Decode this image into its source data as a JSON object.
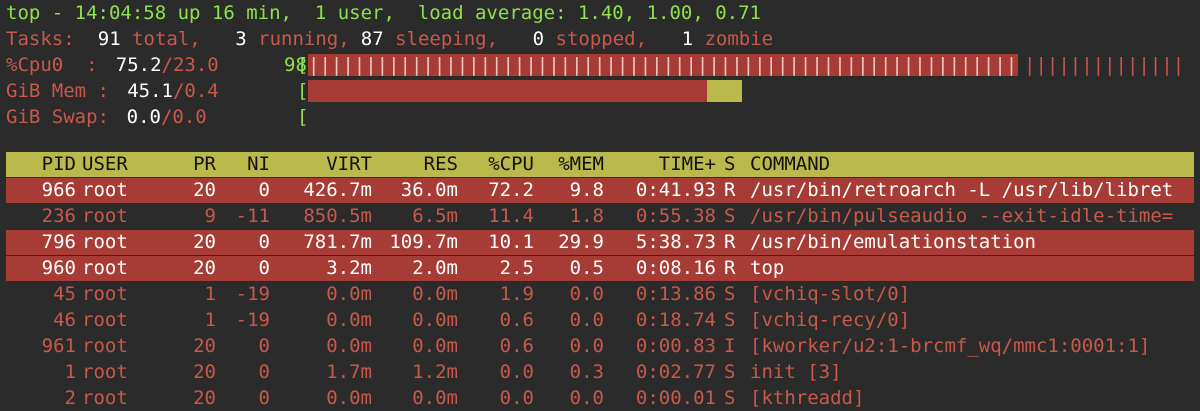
{
  "summary": {
    "line1": "top - 14:04:58 up 16 min,  1 user,  load average: 1.40, 1.00, 0.71",
    "tasks_label": "Tasks:",
    "tasks_total": "91",
    "tasks_total_label": " total,",
    "tasks_running": "3",
    "tasks_running_label": " running,",
    "tasks_sleeping": "87",
    "tasks_sleeping_label": " sleeping,",
    "tasks_stopped": "0",
    "tasks_stopped_label": " stopped,",
    "tasks_zombie": "1",
    "tasks_zombie_label": " zombie",
    "cpu_label": "%Cpu0  :",
    "cpu_user": "75.2",
    "cpu_sys": "/23.0",
    "cpu_total": "98",
    "cpu_bar_open": "[",
    "cpu_usage_fraction": 0.98,
    "mem_label": "GiB Mem :",
    "mem_used": "45.1",
    "mem_buff": "/0.4",
    "mem_bar_open": "[",
    "mem_used_fraction": 0.451,
    "mem_buff_fraction": 0.04,
    "swap_label": "GiB Swap:",
    "swap_used": "0.0",
    "swap_total": "/0.0",
    "swap_bar_open": "["
  },
  "table": {
    "headers": {
      "pid": "PID",
      "user": "USER",
      "pr": "PR",
      "ni": "NI",
      "virt": "VIRT",
      "res": "RES",
      "cpu": "%CPU",
      "mem": "%MEM",
      "time": "TIME+",
      "s": "S",
      "command": "COMMAND"
    },
    "rows": [
      {
        "pid": "966",
        "user": "root",
        "pr": "20",
        "ni": "0",
        "virt": "426.7m",
        "res": "36.0m",
        "cpu": "72.2",
        "mem": "9.8",
        "time": "0:41.93",
        "s": "R",
        "command": "/usr/bin/retroarch -L /usr/lib/libret",
        "style": "hl"
      },
      {
        "pid": "236",
        "user": "root",
        "pr": "9",
        "ni": "-11",
        "virt": "850.5m",
        "res": "6.5m",
        "cpu": "11.4",
        "mem": "1.8",
        "time": "0:55.38",
        "s": "S",
        "command": "/usr/bin/pulseaudio --exit-idle-time=",
        "style": "dim"
      },
      {
        "pid": "796",
        "user": "root",
        "pr": "20",
        "ni": "0",
        "virt": "781.7m",
        "res": "109.7m",
        "cpu": "10.1",
        "mem": "29.9",
        "time": "5:38.73",
        "s": "R",
        "command": "/usr/bin/emulationstation",
        "style": "hl"
      },
      {
        "pid": "960",
        "user": "root",
        "pr": "20",
        "ni": "0",
        "virt": "3.2m",
        "res": "2.0m",
        "cpu": "2.5",
        "mem": "0.5",
        "time": "0:08.16",
        "s": "R",
        "command": "top",
        "style": "hl"
      },
      {
        "pid": "45",
        "user": "root",
        "pr": "1",
        "ni": "-19",
        "virt": "0.0m",
        "res": "0.0m",
        "cpu": "1.9",
        "mem": "0.0",
        "time": "0:13.86",
        "s": "S",
        "command": "[vchiq-slot/0]",
        "style": "dim"
      },
      {
        "pid": "46",
        "user": "root",
        "pr": "1",
        "ni": "-19",
        "virt": "0.0m",
        "res": "0.0m",
        "cpu": "0.6",
        "mem": "0.0",
        "time": "0:18.74",
        "s": "S",
        "command": "[vchiq-recy/0]",
        "style": "dim"
      },
      {
        "pid": "961",
        "user": "root",
        "pr": "20",
        "ni": "0",
        "virt": "0.0m",
        "res": "0.0m",
        "cpu": "0.6",
        "mem": "0.0",
        "time": "0:00.83",
        "s": "I",
        "command": "[kworker/u2:1-brcmf_wq/mmc1:0001:1]",
        "style": "dim"
      },
      {
        "pid": "1",
        "user": "root",
        "pr": "20",
        "ni": "0",
        "virt": "1.7m",
        "res": "1.2m",
        "cpu": "0.0",
        "mem": "0.3",
        "time": "0:02.77",
        "s": "S",
        "command": "init [3]",
        "style": "dim"
      },
      {
        "pid": "2",
        "user": "root",
        "pr": "20",
        "ni": "0",
        "virt": "0.0m",
        "res": "0.0m",
        "cpu": "0.0",
        "mem": "0.0",
        "time": "0:00.01",
        "s": "S",
        "command": "[kthreadd]",
        "style": "dim"
      }
    ]
  },
  "colors": {
    "background": "#2b2b2b",
    "header_green": "#8fe04d",
    "label_red": "#c8584a",
    "highlight_row": "#a63c35",
    "header_bar": "#b9b94c"
  }
}
